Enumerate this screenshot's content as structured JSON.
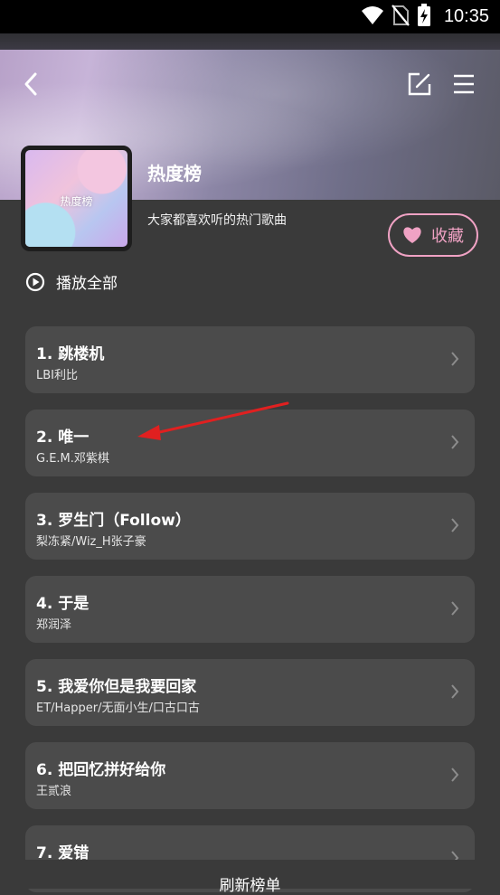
{
  "status_bar": {
    "time": "10:35",
    "icons": [
      "wifi-icon",
      "no-sim-icon",
      "battery-charging-icon"
    ]
  },
  "header": {
    "back_icon": "chevron-left-icon",
    "edit_icon": "edit-icon",
    "menu_icon": "menu-icon"
  },
  "playlist": {
    "cover_label": "热度榜",
    "title": "热度榜",
    "description": "大家都喜欢听的热门歌曲",
    "favorite_label": "收藏",
    "play_all_label": "播放全部"
  },
  "songs": [
    {
      "title": "1. 跳楼机",
      "artist": "LBI利比"
    },
    {
      "title": "2. 唯一",
      "artist": "G.E.M.邓紫棋"
    },
    {
      "title": "3. 罗生门（Follow）",
      "artist": "梨冻紧/Wiz_H张子豪"
    },
    {
      "title": "4. 于是",
      "artist": "郑润泽"
    },
    {
      "title": "5. 我爱你但是我要回家",
      "artist": "ET/Happer/无面小生/口古口古"
    },
    {
      "title": "6. 把回忆拼好给你",
      "artist": "王贰浪"
    },
    {
      "title": "7. 爱错",
      "artist": ""
    }
  ],
  "footer": {
    "refresh_label": "刷新榜单"
  },
  "colors": {
    "accent": "#f0a2c4",
    "background": "#3a3a3a",
    "card": "#4b4b4b",
    "annotation_arrow": "#e02020"
  }
}
